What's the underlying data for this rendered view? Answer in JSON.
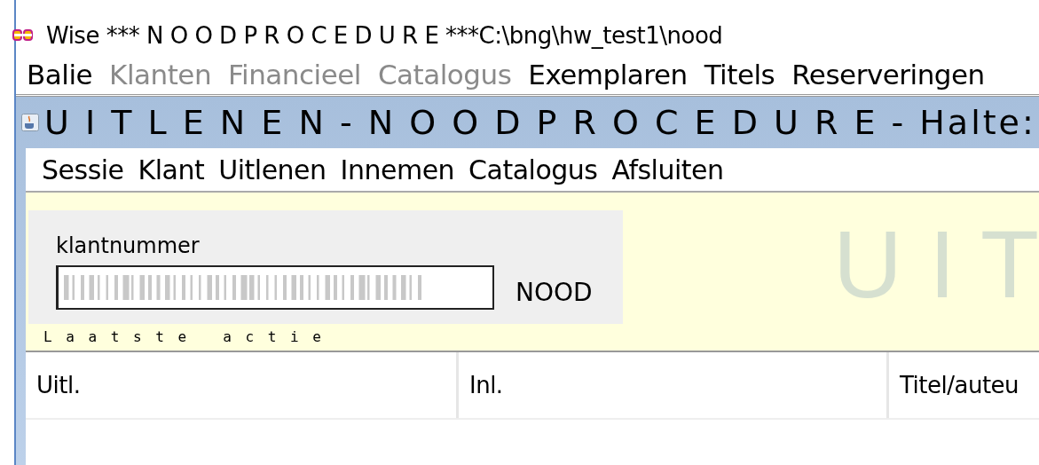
{
  "window": {
    "title": "Wise *** N O O D P R O C E D U R E ***C:\\bng\\hw_test1\\nood"
  },
  "menu": [
    {
      "label": "Balie",
      "disabled": false
    },
    {
      "label": "Klanten",
      "disabled": true
    },
    {
      "label": "Financieel",
      "disabled": true
    },
    {
      "label": "Catalogus",
      "disabled": true
    },
    {
      "label": "Exemplaren",
      "disabled": false
    },
    {
      "label": "Titels",
      "disabled": false
    },
    {
      "label": "Reserveringen",
      "disabled": false
    }
  ],
  "inner_window": {
    "title": "U I T L E N E N - N O O D P R O C E D U R E - Halte:",
    "menu": [
      "Sessie",
      "Klant",
      "Uitlenen",
      "Innemen",
      "Catalogus",
      "Afsluiten"
    ],
    "customer_panel": {
      "label": "klantnummer",
      "mode": "NOOD"
    },
    "banner": "U I T",
    "last_action_label": "L a a t s t e   a c t i e",
    "table": {
      "columns": [
        "Uitl.",
        "Inl.",
        "Titel/auteu"
      ]
    }
  }
}
